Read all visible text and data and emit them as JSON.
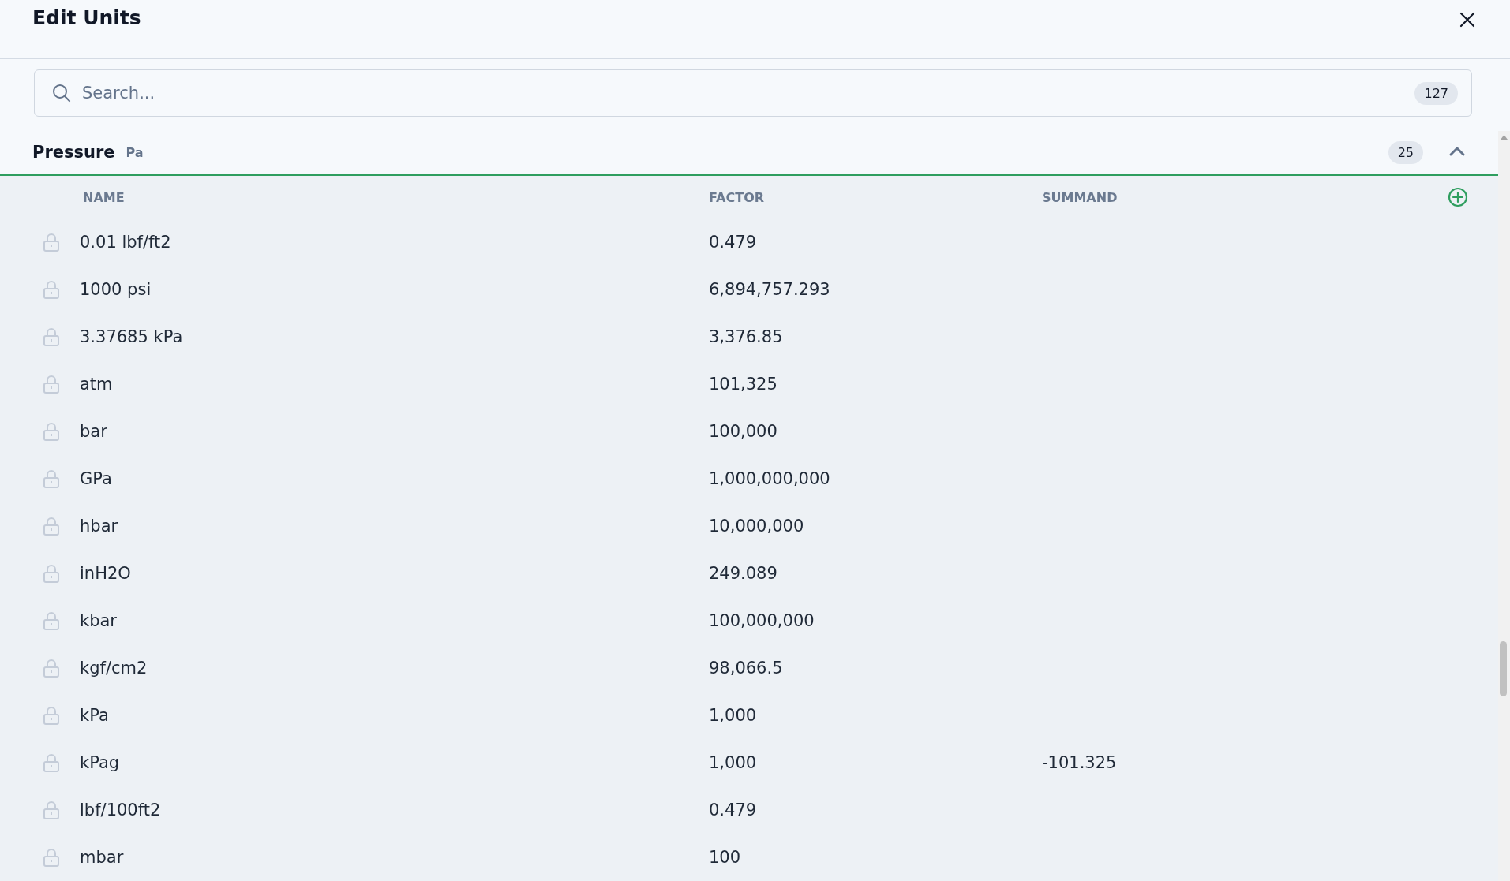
{
  "dialog": {
    "title": "Edit Units"
  },
  "search": {
    "placeholder": "Search...",
    "count": "127"
  },
  "section": {
    "name": "Pressure",
    "base_unit": "Pa",
    "count": "25",
    "expanded": true,
    "columns": [
      "NAME",
      "FACTOR",
      "SUMMAND"
    ],
    "rows": [
      {
        "name": "0.01 lbf/ft2",
        "factor": "0.479",
        "summand": "",
        "locked": true
      },
      {
        "name": "1000 psi",
        "factor": "6,894,757.293",
        "summand": "",
        "locked": true
      },
      {
        "name": "3.37685 kPa",
        "factor": "3,376.85",
        "summand": "",
        "locked": true
      },
      {
        "name": "atm",
        "factor": "101,325",
        "summand": "",
        "locked": true
      },
      {
        "name": "bar",
        "factor": "100,000",
        "summand": "",
        "locked": true
      },
      {
        "name": "GPa",
        "factor": "1,000,000,000",
        "summand": "",
        "locked": true
      },
      {
        "name": "hbar",
        "factor": "10,000,000",
        "summand": "",
        "locked": true
      },
      {
        "name": "inH2O",
        "factor": "249.089",
        "summand": "",
        "locked": true
      },
      {
        "name": "kbar",
        "factor": "100,000,000",
        "summand": "",
        "locked": true
      },
      {
        "name": "kgf/cm2",
        "factor": "98,066.5",
        "summand": "",
        "locked": true
      },
      {
        "name": "kPa",
        "factor": "1,000",
        "summand": "",
        "locked": true
      },
      {
        "name": "kPag",
        "factor": "1,000",
        "summand": "-101.325",
        "locked": true
      },
      {
        "name": "lbf/100ft2",
        "factor": "0.479",
        "summand": "",
        "locked": true
      },
      {
        "name": "mbar",
        "factor": "100",
        "summand": "",
        "locked": true
      }
    ]
  }
}
